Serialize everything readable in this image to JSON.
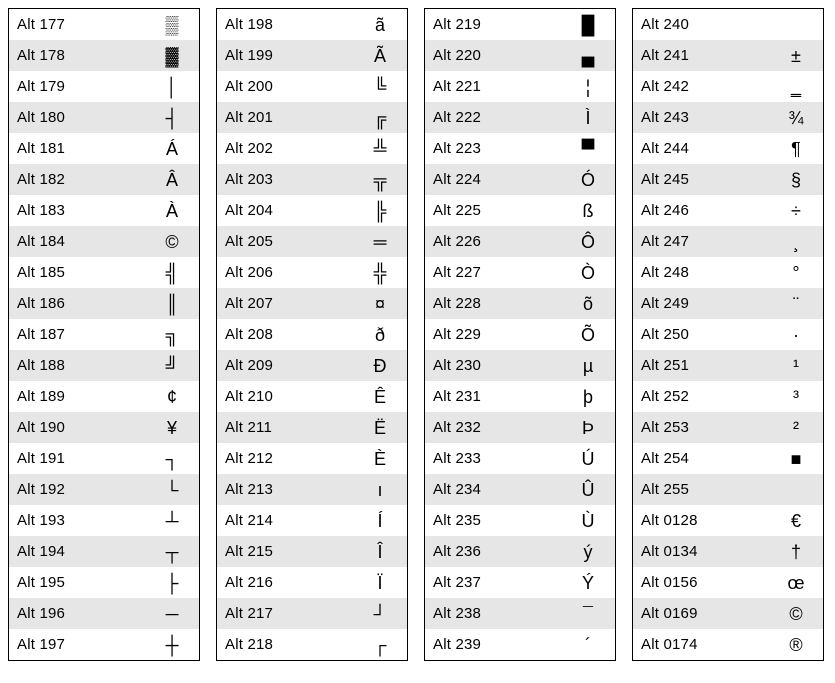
{
  "columns": [
    {
      "rows": [
        {
          "label": "Alt 177",
          "symbol": "▒"
        },
        {
          "label": "Alt 178",
          "symbol": "▓"
        },
        {
          "label": "Alt 179",
          "symbol": "│"
        },
        {
          "label": "Alt 180",
          "symbol": "┤"
        },
        {
          "label": "Alt 181",
          "symbol": "Á"
        },
        {
          "label": "Alt 182",
          "symbol": "Â"
        },
        {
          "label": "Alt 183",
          "symbol": "À"
        },
        {
          "label": "Alt 184",
          "symbol": "©"
        },
        {
          "label": "Alt 185",
          "symbol": "╣"
        },
        {
          "label": "Alt 186",
          "symbol": "║"
        },
        {
          "label": "Alt 187",
          "symbol": "╗"
        },
        {
          "label": "Alt 188",
          "symbol": "╝"
        },
        {
          "label": "Alt 189",
          "symbol": "¢"
        },
        {
          "label": "Alt 190",
          "symbol": "¥"
        },
        {
          "label": "Alt 191",
          "symbol": "┐"
        },
        {
          "label": "Alt 192",
          "symbol": "└"
        },
        {
          "label": "Alt 193",
          "symbol": "┴"
        },
        {
          "label": "Alt 194",
          "symbol": "┬"
        },
        {
          "label": "Alt 195",
          "symbol": "├"
        },
        {
          "label": "Alt 196",
          "symbol": "─"
        },
        {
          "label": "Alt 197",
          "symbol": "┼"
        }
      ]
    },
    {
      "rows": [
        {
          "label": "Alt 198",
          "symbol": "ã"
        },
        {
          "label": "Alt 199",
          "symbol": "Ã"
        },
        {
          "label": "Alt 200",
          "symbol": "╚"
        },
        {
          "label": "Alt 201",
          "symbol": "╔"
        },
        {
          "label": "Alt 202",
          "symbol": "╩"
        },
        {
          "label": "Alt 203",
          "symbol": "╦"
        },
        {
          "label": "Alt 204",
          "symbol": "╠"
        },
        {
          "label": "Alt 205",
          "symbol": "═"
        },
        {
          "label": "Alt 206",
          "symbol": "╬"
        },
        {
          "label": "Alt 207",
          "symbol": "¤"
        },
        {
          "label": "Alt 208",
          "symbol": "ð"
        },
        {
          "label": "Alt 209",
          "symbol": "Ð"
        },
        {
          "label": "Alt 210",
          "symbol": "Ê"
        },
        {
          "label": "Alt 211",
          "symbol": "Ë"
        },
        {
          "label": "Alt 212",
          "symbol": "È"
        },
        {
          "label": "Alt 213",
          "symbol": "ı"
        },
        {
          "label": "Alt 214",
          "symbol": "Í"
        },
        {
          "label": "Alt 215",
          "symbol": "Î"
        },
        {
          "label": "Alt 216",
          "symbol": "Ï"
        },
        {
          "label": "Alt 217",
          "symbol": "┘"
        },
        {
          "label": "Alt 218",
          "symbol": "┌"
        }
      ]
    },
    {
      "rows": [
        {
          "label": "Alt 219",
          "symbol": "█"
        },
        {
          "label": "Alt 220",
          "symbol": "▄"
        },
        {
          "label": "Alt 221",
          "symbol": "¦"
        },
        {
          "label": "Alt 222",
          "symbol": "Ì"
        },
        {
          "label": "Alt 223",
          "symbol": "▀"
        },
        {
          "label": "Alt 224",
          "symbol": "Ó"
        },
        {
          "label": "Alt 225",
          "symbol": "ß"
        },
        {
          "label": "Alt 226",
          "symbol": "Ô"
        },
        {
          "label": "Alt 227",
          "symbol": "Ò"
        },
        {
          "label": "Alt 228",
          "symbol": "õ"
        },
        {
          "label": "Alt 229",
          "symbol": "Õ"
        },
        {
          "label": "Alt 230",
          "symbol": "µ"
        },
        {
          "label": "Alt 231",
          "symbol": "þ"
        },
        {
          "label": "Alt 232",
          "symbol": "Þ"
        },
        {
          "label": "Alt 233",
          "symbol": "Ú"
        },
        {
          "label": "Alt 234",
          "symbol": "Û"
        },
        {
          "label": "Alt 235",
          "symbol": "Ù"
        },
        {
          "label": "Alt 236",
          "symbol": "ý"
        },
        {
          "label": "Alt 237",
          "symbol": "Ý"
        },
        {
          "label": "Alt 238",
          "symbol": "¯"
        },
        {
          "label": "Alt 239",
          "symbol": "´"
        }
      ]
    },
    {
      "rows": [
        {
          "label": "Alt 240",
          "symbol": "­"
        },
        {
          "label": "Alt 241",
          "symbol": "±"
        },
        {
          "label": "Alt 242",
          "symbol": "‗"
        },
        {
          "label": "Alt 243",
          "symbol": "¾"
        },
        {
          "label": "Alt 244",
          "symbol": "¶"
        },
        {
          "label": "Alt 245",
          "symbol": "§"
        },
        {
          "label": "Alt 246",
          "symbol": "÷"
        },
        {
          "label": "Alt 247",
          "symbol": "¸"
        },
        {
          "label": "Alt 248",
          "symbol": "°"
        },
        {
          "label": "Alt 249",
          "symbol": "¨"
        },
        {
          "label": "Alt 250",
          "symbol": "·"
        },
        {
          "label": "Alt 251",
          "symbol": "¹"
        },
        {
          "label": "Alt 252",
          "symbol": "³"
        },
        {
          "label": "Alt 253",
          "symbol": "²"
        },
        {
          "label": "Alt 254",
          "symbol": "■"
        },
        {
          "label": "Alt 255",
          "symbol": " "
        },
        {
          "label": "Alt 0128",
          "symbol": "€"
        },
        {
          "label": "Alt 0134",
          "symbol": "†"
        },
        {
          "label": "Alt 0156",
          "symbol": "œ"
        },
        {
          "label": "Alt 0169",
          "symbol": "©"
        },
        {
          "label": "Alt 0174",
          "symbol": "®"
        }
      ]
    }
  ]
}
